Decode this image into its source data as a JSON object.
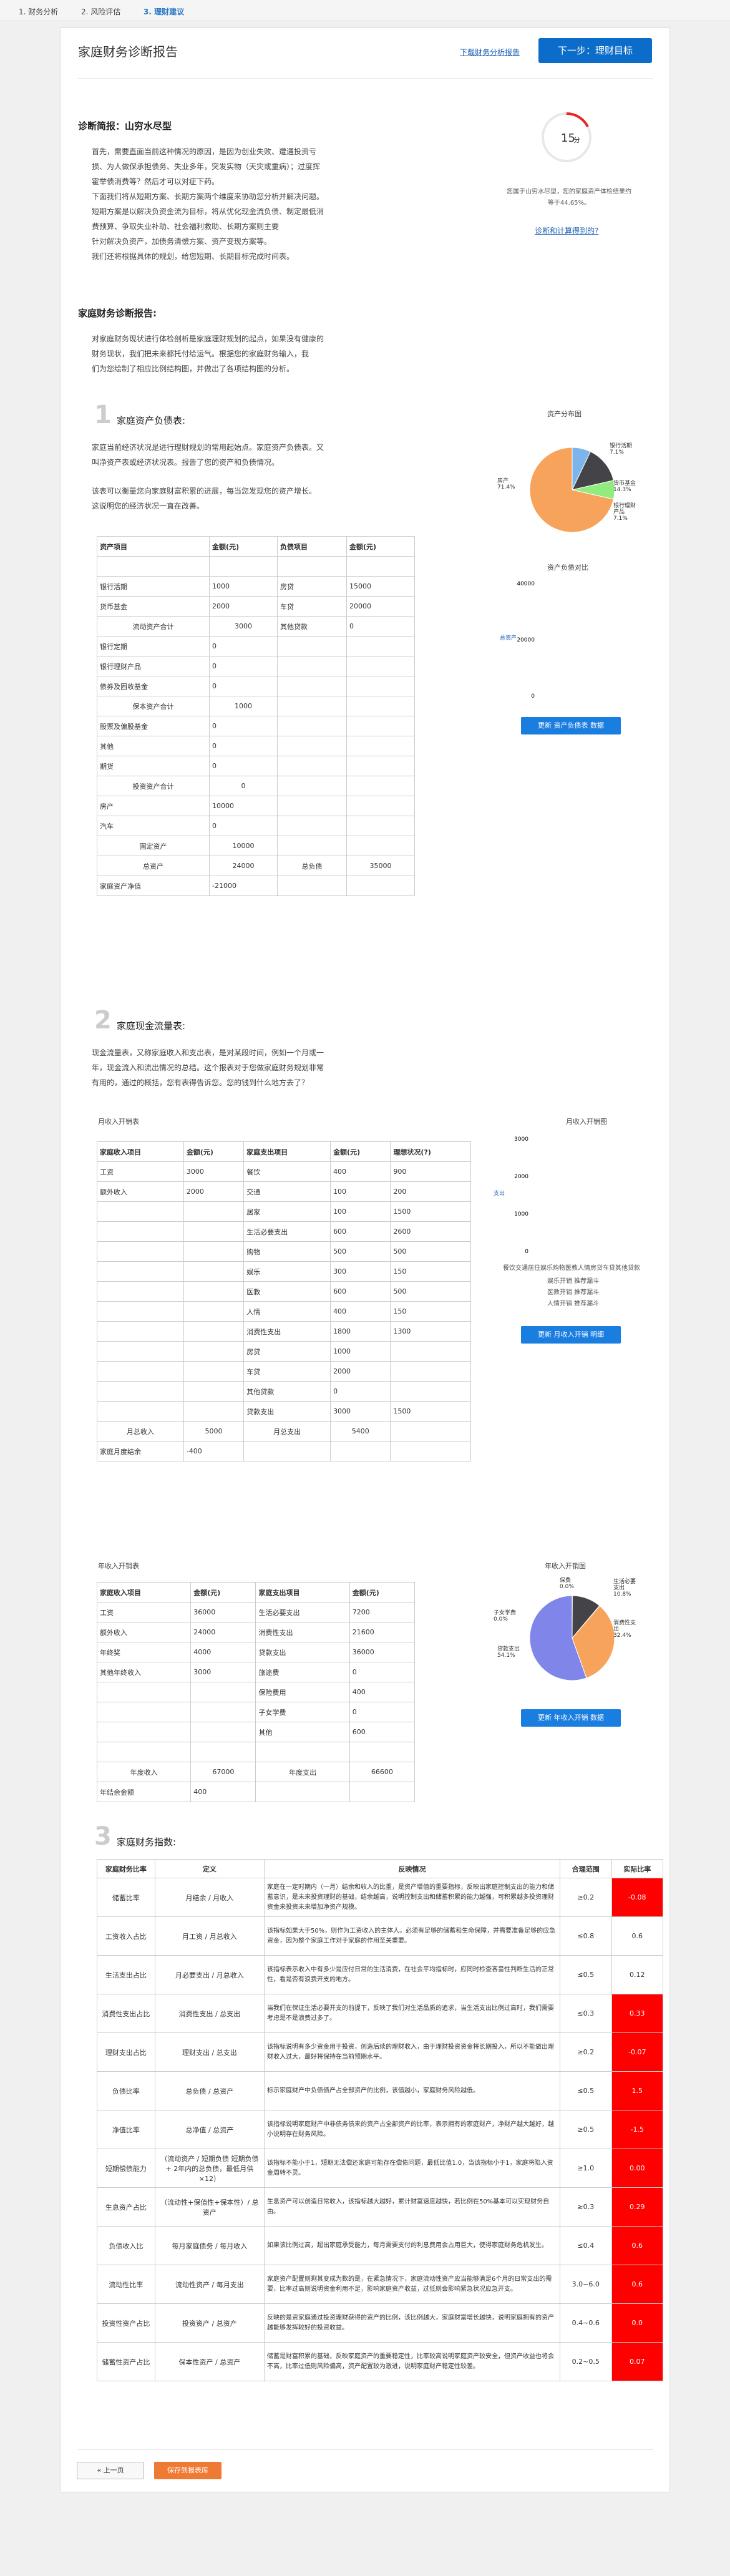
{
  "steps": [
    "1. 财务分析",
    "2. 风险评估",
    "3. 理财建议"
  ],
  "header": {
    "title": "家庭财务诊断报告",
    "download": "下载财务分析报告",
    "next": "下一步：理财目标"
  },
  "diag": {
    "label": "诊断简报：山穷水尽型",
    "lines": [
      "首先，需要直面当前这种情况的原因，是因为创业失败、遭遇投资亏",
      "损、为人做保承担债务、失业多年，突发实物（天灾或重病）；过度挥",
      "霍举债消费等？然后才可以对症下药。",
      "下面我们将从短期方案、长期方案两个维度来协助您分析并解决问题。",
      "短期方案是以解决负资金流为目标，将从优化现金流负债、制定最低消",
      "费预算、争取失业补助、社会福利救助、长期方案则主要",
      "针对解决负资产，加债务清偿方案、资产变现方案等。",
      "我们还将根据具体的规划，给您短期、长期目标完成时间表。"
    ],
    "score": "15",
    "score_note": [
      "您属于山穷水尽型，您的家庭资产体检结果约",
      "等于44.65%。"
    ],
    "score_link": "诊断和计算得到的?"
  },
  "report": {
    "label": "家庭财务诊断报告:",
    "intro": [
      "对家庭财务现状进行体检剖析是家庭理财规划的起点，如果没有健康的",
      "财务现状，我们把未来都托付给运气。根据您的家庭财务输入，我",
      "们为您绘制了相应比例结构图，并做出了各项结构图的分析。"
    ]
  },
  "s1": {
    "num": "1",
    "title": "家庭资产负债表:",
    "p": [
      "家庭当前经济状况是进行理财规划的常用起始点。家庭资产负债表。又",
      "叫净资产表或经济状况表。报告了您的资产和负债情况。"
    ],
    "p2": [
      "该表可以衡量您向家庭财富积累的进展，每当您发现您的资产增长。",
      "这说明您的经济状况一直在改善。"
    ],
    "th": [
      "资产项目",
      "金额(元)",
      "负债项目",
      "金额(元)"
    ],
    "rows": [
      [
        "",
        "",
        "",
        ""
      ],
      [
        "银行活期",
        "1000",
        "房贷",
        "15000"
      ],
      [
        "货币基金",
        "2000",
        "车贷",
        "20000"
      ],
      [
        "流动资产合计",
        "3000",
        "其他贷款",
        "0"
      ],
      [
        "银行定期",
        "0",
        "",
        ""
      ],
      [
        "银行理财产品",
        "0",
        "",
        ""
      ],
      [
        "债券及固收基金",
        "0",
        "",
        ""
      ],
      [
        "保本资产合计",
        "1000",
        "",
        ""
      ],
      [
        "股票及偏股基金",
        "0",
        "",
        ""
      ],
      [
        "其他",
        "0",
        "",
        ""
      ],
      [
        "期货",
        "0",
        "",
        ""
      ],
      [
        "投资资产合计",
        "0",
        "",
        ""
      ],
      [
        "房产",
        "10000",
        "",
        ""
      ],
      [
        "汽车",
        "0",
        "",
        ""
      ],
      [
        "固定资产",
        "10000",
        "",
        ""
      ]
    ],
    "total": [
      "总资产",
      "24000",
      "总负债",
      "35000"
    ],
    "net": [
      "家庭资产净值",
      "-21000"
    ]
  },
  "c1": {
    "title": "资产分布图",
    "labels": [
      "银行活期\n7.1%",
      "货币基金\n14.3%",
      "银行理财\n产品\n7.1%",
      "房产\n71.4%"
    ],
    "bar_title": "资产负债对比",
    "ticks": [
      "40000",
      "20000",
      "0"
    ],
    "leg": "总资产",
    "btn": "更新 资产负债表 数据"
  },
  "s2": {
    "num": "2",
    "title": "家庭现金流量表:",
    "p": [
      "现金流量表，又称家庭收入和支出表，是对某段时间，例如一个月或一",
      "年，现金流入和流出情况的总结。这个报表对于您做家庭财务规划非常",
      "有用的，通过的概括，您有表得告诉您。您的钱到什么地方去了？"
    ],
    "m_title": "月收入开销表",
    "mh": [
      "家庭收入项目",
      "金额(元)",
      "家庭支出项目",
      "金额(元)",
      "理想状况(?)"
    ],
    "mrows": [
      [
        "工资",
        "3000",
        "餐饮",
        "400",
        "900"
      ],
      [
        "额外收入",
        "2000",
        "交通",
        "100",
        "200"
      ],
      [
        "",
        "",
        "居家",
        "100",
        "1500"
      ],
      [
        "",
        "",
        "生活必要支出",
        "600",
        "2600"
      ],
      [
        "",
        "",
        "购物",
        "500",
        "500"
      ],
      [
        "",
        "",
        "娱乐",
        "300",
        "150"
      ],
      [
        "",
        "",
        "医教",
        "600",
        "500"
      ],
      [
        "",
        "",
        "人情",
        "400",
        "150"
      ],
      [
        "",
        "",
        "消费性支出",
        "1800",
        "1300"
      ],
      [
        "",
        "",
        "房贷",
        "1000",
        ""
      ],
      [
        "",
        "",
        "车贷",
        "2000",
        ""
      ],
      [
        "",
        "",
        "其他贷款",
        "0",
        ""
      ],
      [
        "",
        "",
        "贷款支出",
        "3000",
        "1500"
      ]
    ],
    "mtot": [
      "月总收入",
      "5000",
      "月总支出",
      "5400"
    ],
    "mbal": [
      "家庭月度结余",
      "-400"
    ],
    "y_title": "年收入开销表",
    "yh": [
      "家庭收入项目",
      "金额(元)",
      "家庭支出项目",
      "金额(元)"
    ],
    "yrows": [
      [
        "工资",
        "36000",
        "生活必要支出",
        "7200"
      ],
      [
        "额外收入",
        "24000",
        "消费性支出",
        "21600"
      ],
      [
        "年终奖",
        "4000",
        "贷款支出",
        "36000"
      ],
      [
        "其他年终收入",
        "3000",
        "旅途费",
        "0"
      ],
      [
        "",
        "",
        "保险费用",
        "400"
      ],
      [
        "",
        "",
        "子女学费",
        "0"
      ],
      [
        "",
        "",
        "其他",
        "600"
      ]
    ],
    "ytot": [
      "年度收入",
      "67000",
      "年度支出",
      "66600"
    ],
    "ybal": [
      "年结余金额",
      "400"
    ]
  },
  "c2": {
    "title": "月收入开销图",
    "ticks": [
      "3000",
      "2000",
      "1000",
      "0"
    ],
    "leg": "支出",
    "labels": [
      "餐饮交通居住娱乐购物医教人情房贷车贷其他贷款"
    ],
    "leg2": [
      "娱乐开销 推荐漏斗",
      "医教开销 推荐漏斗",
      "人情开销 推荐漏斗"
    ],
    "btn": "更新 月收入开销 明细",
    "ytitle": "年收入开销图",
    "ylabels": [
      "保费\n0.0%",
      "生活必要\n支出\n10.8%",
      "子女学费\n0.0%",
      "消费性支\n出\n32.4%",
      "贷款支出\n54.1%"
    ],
    "ybtn": "更新 年收入开销 数据"
  },
  "s3": {
    "num": "3",
    "title": "家庭财务指数:",
    "th": [
      "家庭财务比率",
      "定义",
      "反映情况",
      "合理范围",
      "实际比率"
    ],
    "rows": [
      [
        "储蓄比率",
        "月结余 / 月收入",
        "家庭在一定时期内（一月）结余和收入的比重，是资产增值的重要指标，反映出家庭控制支出的能力和储蓄意识，是未来投资理财的基础，结余越高，说明控制支出和储蓄积累的能力越强，可积累越多投资理财资金来投资未来增加净资产规模。",
        "≥0.2",
        "-0.08",
        true
      ],
      [
        "工资收入占比",
        "月工资 / 月总收入",
        "该指标如果大于50%，则作为工资收入的主体人。必须有足够的储蓄和生命保障，并需要准备足够的应急资金，因为整个家庭工作对于家庭的作用至关重要。",
        "≤0.8",
        "0.6",
        false
      ],
      [
        "生活支出占比",
        "月必要支出 / 月总收入",
        "该指标表示收入中有多少是应付日常的生活消费，在社会平均指标时，应同时检查吝啬性判断生活的正常性，看是否有浪费开支的地方。",
        "≤0.5",
        "0.12",
        false
      ],
      [
        "消费性支出占比",
        "消费性支出 / 总支出",
        "当我们在保证生活必要开支的前提下，反映了我们对生活品质的追求，当生活支出比例过高时，我们需要考虑是不是浪费过多了。",
        "≤0.3",
        "0.33",
        true
      ],
      [
        "理财支出占比",
        "理财支出 / 总支出",
        "该指标说明有多少资金用于投资，创造后续的理财收入，由于理财投资资金将长期投入，所以不能做出理财收入过大，最好将保持在当前预期水平。",
        "≥0.2",
        "-0.07",
        true
      ],
      [
        "负债比率",
        "总负债 / 总资产",
        "标示家庭财产中负债债产占全部资产的比例，该值越小，家庭财务风险越低。",
        "≤0.5",
        "1.5",
        true
      ],
      [
        "净值比率",
        "总净值 / 总资产",
        "该指标说明家庭财产中非债务债来的资产占全部资产的比率，表示拥有的家庭财产，净财产越大越好，越小说明存在财务风险。",
        "≥0.5",
        "-1.5",
        true
      ],
      [
        "短期偿债能力",
        "（流动资产 / 短期负债 短期负债 + 2年内的总负债，最低月供×12）",
        "该指标不能小于1，短期无法偿还家庭可能存在偿债问题，最低比值1.0，当该指标小于1，家庭将陷入资金周转不灵。",
        "≥1.0",
        "0.00",
        true
      ],
      [
        "生息资产占比",
        "（流动性+保值性+保本性）/ 总资产",
        "生息资产可以创造日常收入，该指标越大越好，累计财富速度越快，若比例在50%基本可以实现财务自由。",
        "≥0.3",
        "0.29",
        true
      ],
      [
        "负债收入比",
        "每月家庭债务 / 每月收入",
        "如果该比例过高，超出家庭承受能力，每月需要支付的利息费用会占用巨大，使得家庭财务危机发生。",
        "≤0.4",
        "0.6",
        true
      ],
      [
        "流动性比率",
        "流动性资产 / 每月支出",
        "家庭资产配置则剩其变成为数的是，在紧急情况下，家庭流动性资产应当能够满足6个月的日常支出的需要，比率过高则说明资金利用不足，影响家庭资产收益，过低则会影响紧急状况应急开支。",
        "3.0~6.0",
        "0.6",
        true
      ],
      [
        "投资性资产占比",
        "投资资产 / 总资产",
        "反映的是资家庭通过投资理财获得的资产的比例，该比例越大，家庭财富增长越快，说明家庭拥有的资产越能够发挥较好的投资收益。",
        "0.4~0.6",
        "0.0",
        true
      ],
      [
        "储蓄性资产占比",
        "保本性资产 / 总资产",
        "储蓄是财富积累的基础，反映家庭资产的重要稳定性，比率较高说明家庭资产较安全，但资产收益也将会不高，比率过低则风险偏高，资产配置较为激进，说明家庭财产稳定性较差。",
        "0.2~0.5",
        "0.07",
        true
      ]
    ]
  },
  "footer": {
    "prev": "« 上一页",
    "next": "保存到报表库"
  }
}
